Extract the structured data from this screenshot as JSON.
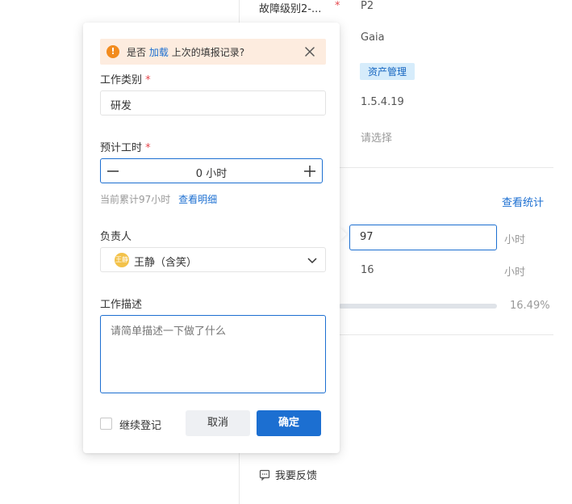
{
  "background": {
    "fields": [
      {
        "label": "故障级别2-...",
        "required": true,
        "value": "P2"
      },
      {
        "value": "Gaia"
      },
      {
        "tag": "资产管理"
      },
      {
        "value": "1.5.4.19"
      },
      {
        "placeholder": "请选择"
      }
    ],
    "view_stats_link": "查看统计",
    "rows": [
      {
        "value": "97",
        "unit": "小时"
      },
      {
        "value": "16",
        "unit": "小时"
      }
    ],
    "progress": {
      "percent_text": "16.49%",
      "fraction": 0.1649
    },
    "feedback_label": "我要反馈"
  },
  "popover": {
    "banner": {
      "prefix": "是否",
      "link": "加载",
      "suffix": "上次的填报记录?"
    },
    "work_type": {
      "label": "工作类别",
      "required_mark": "*",
      "value": "研发"
    },
    "est_hours": {
      "label": "预计工时",
      "required_mark": "*",
      "value": "0 小时",
      "hint": "当前累计97小时",
      "hint_link": "查看明细"
    },
    "owner": {
      "label": "负责人",
      "avatar_text": "王静",
      "value": "王静（含笑）"
    },
    "description": {
      "label": "工作描述",
      "placeholder": "请简单描述一下做了什么"
    },
    "footer": {
      "continue_label": "继续登记",
      "cancel_label": "取消",
      "ok_label": "确定"
    }
  },
  "colors": {
    "accent": "#1c6fd1",
    "warning": "#f28b1e",
    "banner_bg": "#fdecdf",
    "tag_bg": "#d6ecfb"
  }
}
